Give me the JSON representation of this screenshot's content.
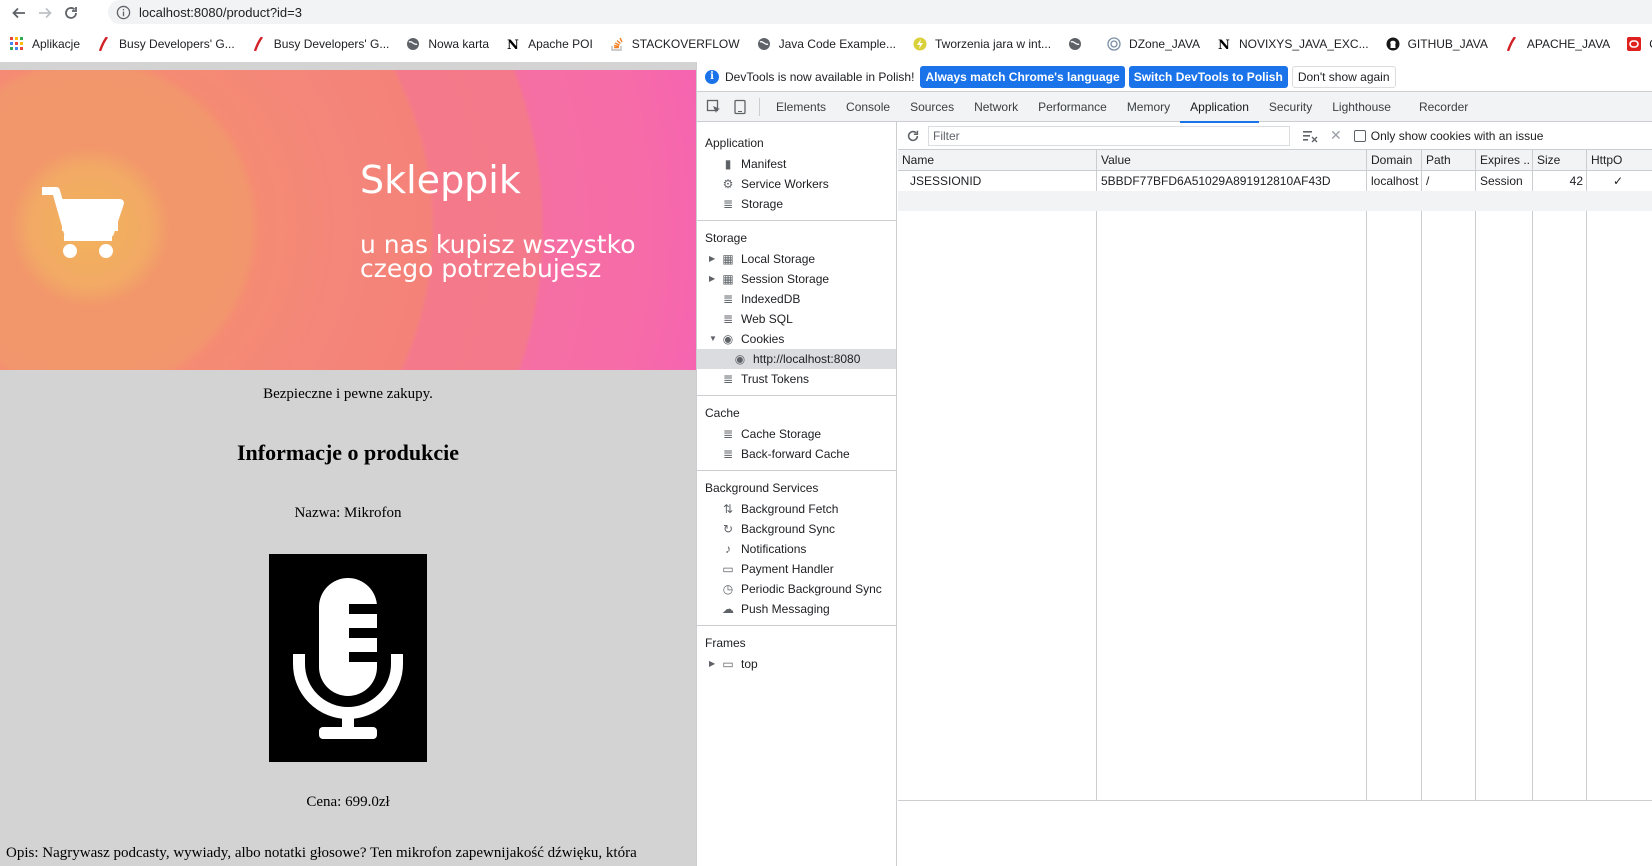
{
  "browser": {
    "url": "localhost:8080/product?id=3",
    "bookmarks": [
      {
        "label": "Aplikacje",
        "icon": "apps-grid-icon"
      },
      {
        "label": "Busy Developers' G...",
        "icon": "feather-icon"
      },
      {
        "label": "Busy Developers' G...",
        "icon": "feather-icon"
      },
      {
        "label": "Nowa karta",
        "icon": "globe-icon"
      },
      {
        "label": "Apache POI",
        "icon": "n-logo-icon"
      },
      {
        "label": "STACKOVERFLOW",
        "icon": "stackoverflow-icon"
      },
      {
        "label": "Java Code Example...",
        "icon": "globe-icon"
      },
      {
        "label": "Tworzenia jara w int...",
        "icon": "bolt-icon"
      },
      {
        "label": "",
        "icon": "globe-icon"
      },
      {
        "label": "DZone_JAVA",
        "icon": "dzone-icon"
      },
      {
        "label": "NOVIXYS_JAVA_EXC...",
        "icon": "n-logo-icon"
      },
      {
        "label": "GITHUB_JAVA",
        "icon": "github-icon"
      },
      {
        "label": "APACHE_JAVA",
        "icon": "feather-icon"
      },
      {
        "label": "ORACLE_JAVA",
        "icon": "oracle-icon"
      }
    ]
  },
  "page": {
    "shop_title": "Skleppik",
    "shop_subtitle": "u nas kupisz wszystko czego potrzebujesz",
    "secure_text": "Bezpieczne i pewne zakupy.",
    "info_title": "Informacje o produkcie",
    "product_name": "Nazwa: Mikrofon",
    "price": "Cena: 699.0zł",
    "description": "Opis: Nagrywasz podcasty, wywiady, albo notatki głosowe? Ten mikrofon zapewnijakość dźwięku, która"
  },
  "devtools": {
    "infobar": {
      "message": "DevTools is now available in Polish!",
      "btn_match": "Always match Chrome's language",
      "btn_switch": "Switch DevTools to Polish",
      "btn_dismiss": "Don't show again"
    },
    "tabs": [
      "Elements",
      "Console",
      "Sources",
      "Network",
      "Performance",
      "Memory",
      "Application",
      "Security",
      "Lighthouse",
      "Recorder"
    ],
    "active_tab": "Application",
    "sidebar": {
      "application_header": "Application",
      "application_items": [
        "Manifest",
        "Service Workers",
        "Storage"
      ],
      "storage_header": "Storage",
      "storage_items": [
        "Local Storage",
        "Session Storage",
        "IndexedDB",
        "Web SQL",
        "Cookies"
      ],
      "cookie_origin": "http://localhost:8080",
      "trust_tokens": "Trust Tokens",
      "cache_header": "Cache",
      "cache_items": [
        "Cache Storage",
        "Back-forward Cache"
      ],
      "background_header": "Background Services",
      "background_items": [
        "Background Fetch",
        "Background Sync",
        "Notifications",
        "Payment Handler",
        "Periodic Background Sync",
        "Push Messaging"
      ],
      "frames_header": "Frames",
      "frames_item": "top"
    },
    "toolbar": {
      "filter_placeholder": "Filter",
      "only_issues_label": "Only show cookies with an issue"
    },
    "cookie_table": {
      "columns": [
        "Name",
        "Value",
        "Domain",
        "Path",
        "Expires ..",
        "Size",
        "HttpO"
      ],
      "rows": [
        {
          "name": "JSESSIONID",
          "value": "5BBDF77BFD6A51029A891912810AF43D",
          "domain": "localhost",
          "path": "/",
          "expires": "Session",
          "size": "42",
          "httponly": "✓"
        }
      ]
    }
  }
}
